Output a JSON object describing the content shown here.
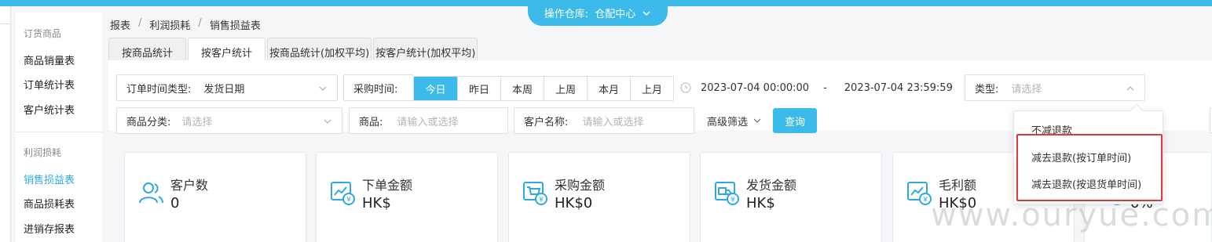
{
  "warehouse": {
    "label": "操作仓库:",
    "value": "仓配中心"
  },
  "sidebar": {
    "groups": [
      {
        "title": "订货商品",
        "items": [
          "商品销量表",
          "订单统计表",
          "客户统计表"
        ]
      },
      {
        "title": "利润损耗",
        "items": [
          "销售损益表",
          "商品损耗表",
          "进销存报表"
        ]
      }
    ],
    "active_item": "销售损益表"
  },
  "breadcrumb": [
    "报表",
    "利润损耗",
    "销售损益表"
  ],
  "tabs": [
    {
      "label": "按商品统计",
      "active": false
    },
    {
      "label": "按客户统计",
      "active": true
    },
    {
      "label": "按商品统计(加权平均)",
      "active": false
    },
    {
      "label": "按客户统计(加权平均)",
      "active": false
    }
  ],
  "filters": {
    "order_time_type": {
      "label": "订单时间类型:",
      "value": "发货日期"
    },
    "purchase_time": {
      "label": "采购时间:",
      "options": [
        "今日",
        "昨日",
        "本周",
        "上周",
        "本月",
        "上月"
      ],
      "selected": "今日"
    },
    "date_range": {
      "start": "2023-07-04 00:00:00",
      "separator": "-",
      "end": "2023-07-04 23:59:59"
    },
    "type": {
      "label": "类型:",
      "placeholder": "请选择"
    },
    "category": {
      "label": "商品分类:",
      "placeholder": "请选择"
    },
    "product": {
      "label": "商品:",
      "placeholder": "请输入或选择"
    },
    "customer": {
      "label": "客户名称:",
      "placeholder": "请输入或选择"
    },
    "advanced": "高级筛选",
    "query": "查询"
  },
  "type_dropdown": {
    "options": [
      "不减退款",
      "减去退款(按订单时间)",
      "减去退款(按退货单时间)"
    ]
  },
  "cards": [
    {
      "icon": "users-icon",
      "title": "客户数",
      "value": "0"
    },
    {
      "icon": "chart-money-icon",
      "title": "下单金额",
      "value": "HK$"
    },
    {
      "icon": "cart-money-icon",
      "title": "采购金额",
      "value": "HK$0"
    },
    {
      "icon": "truck-money-icon",
      "title": "发货金额",
      "value": "HK$"
    },
    {
      "icon": "chart-money-icon",
      "title": "毛利额",
      "value": "HK$0"
    },
    {
      "icon": "chart-money-icon",
      "title": "",
      "value": "0%"
    }
  ],
  "watermark": "www.ouryue.com",
  "colors": {
    "accent": "#3cbaea",
    "highlight_box": "#e03a3a"
  }
}
